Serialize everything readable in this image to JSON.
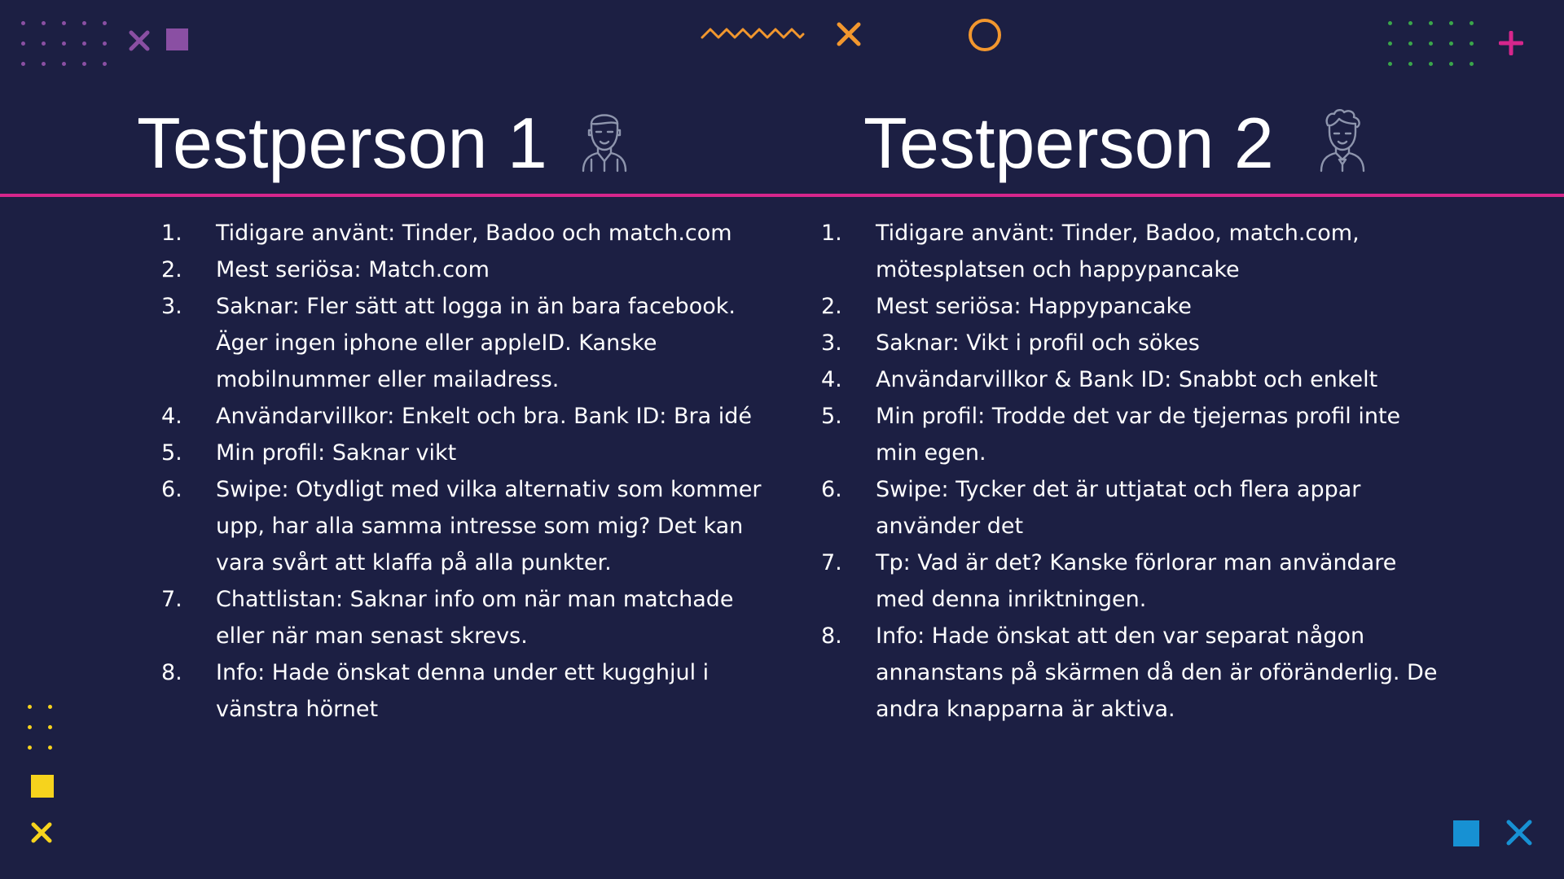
{
  "colors": {
    "background": "#1c1f43",
    "divider": "#d6268c",
    "text": "#ffffff",
    "icon_gray": "#8e95ad",
    "deco_purple": "#8a4fa3",
    "deco_orange": "#f2972e",
    "deco_green": "#3aa64a",
    "deco_pink": "#d6268c",
    "deco_yellow": "#f6d31d",
    "deco_blue": "#1791d3"
  },
  "left": {
    "title": "Testperson 1",
    "avatar_icon": "man-avatar-icon",
    "items": [
      {
        "num": "1.",
        "text": "Tidigare använt: Tinder, Badoo och match.com"
      },
      {
        "num": "2.",
        "text": "Mest seriösa: Match.com"
      },
      {
        "num": "3.",
        "text": "Saknar: Fler sätt att logga in än bara facebook. Äger ingen iphone eller appleID. Kanske mobilnummer eller mailadress."
      },
      {
        "num": "4.",
        "text": "Användarvillkor: Enkelt och bra. Bank ID: Bra idé"
      },
      {
        "num": "5.",
        "text": "Min profil: Saknar vikt"
      },
      {
        "num": "6.",
        "text": "Swipe: Otydligt med vilka alternativ som kommer upp, har alla samma intresse som mig? Det kan vara svårt att klaffa på alla punkter."
      },
      {
        "num": "7.",
        "text": "Chattlistan: Saknar info om när man matchade eller när man senast skrevs."
      },
      {
        "num": "8.",
        "text": "Info: Hade önskat denna under ett kugghjul i vänstra hörnet"
      }
    ]
  },
  "right": {
    "title": "Testperson 2",
    "avatar_icon": "curly-hair-man-avatar-icon",
    "items": [
      {
        "num": "1.",
        "text": "Tidigare använt: Tinder, Badoo, match.com, mötesplatsen och happypancake"
      },
      {
        "num": "2.",
        "text": "Mest seriösa: Happypancake"
      },
      {
        "num": "3.",
        "text": "Saknar: Vikt i profil och sökes"
      },
      {
        "num": "4.",
        "text": "Användarvillkor & Bank ID: Snabbt och enkelt"
      },
      {
        "num": "5.",
        "text": "Min profil: Trodde det var de tjejernas profil inte min egen."
      },
      {
        "num": "6.",
        "text": "Swipe: Tycker det är uttjatat och flera appar använder det"
      },
      {
        "num": "7.",
        "text": "Tp: Vad är det? Kanske förlorar man användare med denna inriktningen."
      },
      {
        "num": "8.",
        "text": "Info: Hade önskat att den var separat någon annanstans på skärmen då den är oföränderlig. De andra knapparna är aktiva."
      }
    ]
  }
}
